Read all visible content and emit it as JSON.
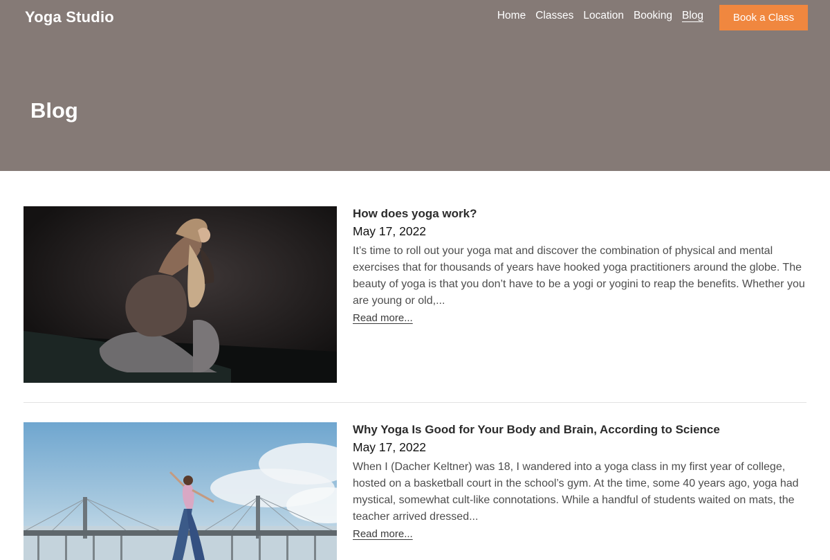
{
  "site": {
    "logo": "Yoga Studio",
    "nav": [
      "Home",
      "Classes",
      "Location",
      "Booking",
      "Blog"
    ],
    "active_nav": "Blog",
    "cta": "Book a Class",
    "brand_color": "#f0873f",
    "header_color": "#857a76"
  },
  "page": {
    "title": "Blog"
  },
  "posts": [
    {
      "title": "How does yoga work?",
      "date": "May 17, 2022",
      "excerpt": "It’s time to roll out your yoga mat and discover the combination of physical and mental exercises that for thousands of years have hooked yoga practitioners around the globe. The beauty of yoga is that you don’t have to be a yogi or yogini to reap the benefits. Whether you are young or old,...",
      "read_more": "Read more..."
    },
    {
      "title": "Why Yoga Is Good for Your Body and Brain, According to Science",
      "date": "May 17, 2022",
      "excerpt": "When I (Dacher Keltner) was 18, I wandered into a yoga class in my first year of college, hosted on a basketball court in the school’s gym. At the time, some 40 years ago, yoga had mystical, somewhat cult-like connotations. While a handful of students waited on mats, the teacher arrived dressed...",
      "read_more": "Read more..."
    }
  ]
}
